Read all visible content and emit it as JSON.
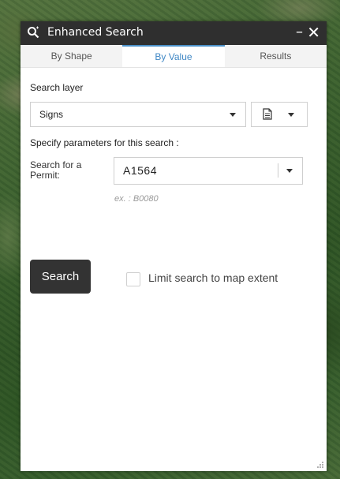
{
  "window": {
    "title": "Enhanced Search",
    "minimize_label": "–",
    "close_label": "✕",
    "title_icon": "search-icon"
  },
  "tabs": [
    {
      "label": "By Shape",
      "active": false
    },
    {
      "label": "By Value",
      "active": true
    },
    {
      "label": "Results",
      "active": false
    }
  ],
  "form": {
    "search_layer_label": "Search layer",
    "search_layer_value": "Signs",
    "params_label": "Specify parameters for this search :",
    "permit_label": "Search for a Permit:",
    "permit_value": "A1564",
    "permit_example": "ex. : B0080",
    "search_button": "Search",
    "limit_checkbox_label": "Limit search to map extent",
    "limit_checked": false
  },
  "colors": {
    "titlebar": "#2f2f2f",
    "active_tab": "#3f87c5",
    "button": "#333333"
  }
}
